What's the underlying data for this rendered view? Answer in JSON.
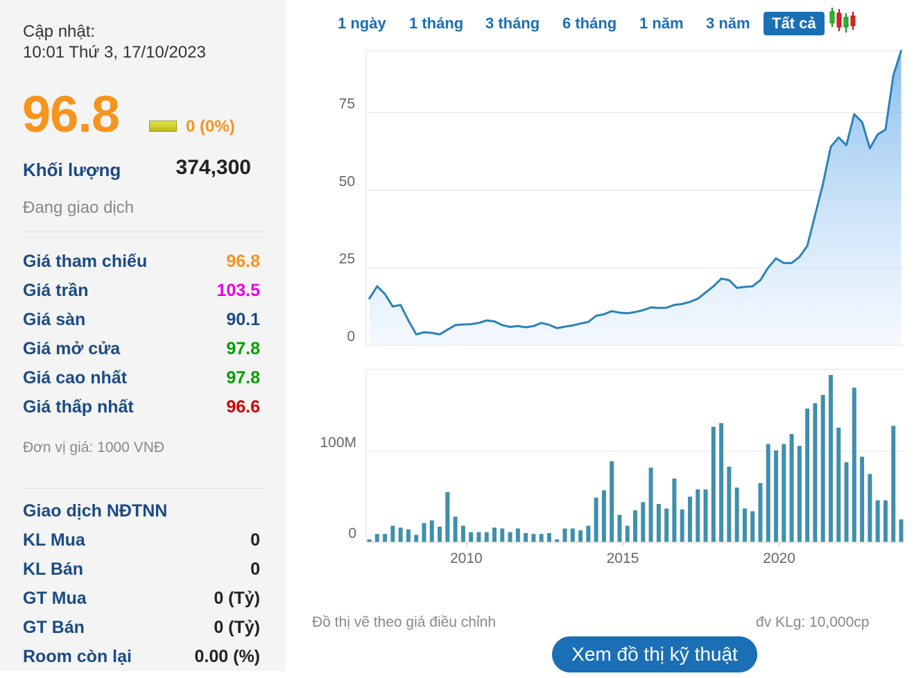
{
  "info": {
    "update_label": "Cập nhật:",
    "update_time": "10:01 Thứ 3, 17/10/2023",
    "price": "96.8",
    "change": "0 (0%)",
    "volume_label": "Khối lượng",
    "volume_value": "374,300",
    "status": "Đang giao dịch",
    "unit_note": "Đơn vị giá: 1000 VNĐ"
  },
  "colors": {
    "ref": "#f7941d",
    "ceiling": "#e600e6",
    "floor": "#1b4b84",
    "up": "#00a000",
    "down": "#d00000",
    "line": "#2b82b6",
    "bar": "#3f8fad"
  },
  "price_rows": [
    {
      "label": "Giá tham chiếu",
      "value": "96.8",
      "color": "#f7941d"
    },
    {
      "label": "Giá trần",
      "value": "103.5",
      "color": "#e600e6"
    },
    {
      "label": "Giá sàn",
      "value": "90.1",
      "color": "#1b4b84"
    },
    {
      "label": "Giá mở cửa",
      "value": "97.8",
      "color": "#00a000"
    },
    {
      "label": "Giá cao nhất",
      "value": "97.8",
      "color": "#00a000"
    },
    {
      "label": "Giá thấp nhất",
      "value": "96.6",
      "color": "#d00000"
    }
  ],
  "foreign": {
    "title": "Giao dịch NĐTNN",
    "rows": [
      {
        "label": "KL Mua",
        "value": "0"
      },
      {
        "label": "KL Bán",
        "value": "0"
      },
      {
        "label": "GT Mua",
        "value": "0 (Tỷ)"
      },
      {
        "label": "GT Bán",
        "value": "0 (Tỷ)"
      },
      {
        "label": "Room còn lại",
        "value": "0.00 (%)"
      }
    ]
  },
  "tabs": [
    {
      "label": "1 ngày",
      "active": false
    },
    {
      "label": "1 tháng",
      "active": false
    },
    {
      "label": "3 tháng",
      "active": false
    },
    {
      "label": "6 tháng",
      "active": false
    },
    {
      "label": "1 năm",
      "active": false
    },
    {
      "label": "3 năm",
      "active": false
    },
    {
      "label": "Tất cả",
      "active": true
    }
  ],
  "candle_icon": "candlestick-chart-icon",
  "footer": {
    "note_left": "Đồ thị vẽ theo giá điều chỉnh",
    "note_right": "đv KLg: 10,000cp",
    "button_label": "Xem đồ thị kỹ thuật"
  },
  "chart_data": [
    {
      "type": "area",
      "title": "",
      "xlabel": "",
      "ylabel": "",
      "x_ticks": [],
      "y_ticks": [
        "0",
        "25",
        "50",
        "75"
      ],
      "ylim": [
        0,
        95
      ],
      "xlim": [
        2006.8,
        2024.0
      ],
      "grid": true,
      "series": [
        {
          "x": [
            2006.9,
            2007.15,
            2007.4,
            2007.65,
            2007.9,
            2008.15,
            2008.4,
            2008.65,
            2008.9,
            2009.15,
            2009.4,
            2009.65,
            2009.9,
            2010.15,
            2010.4,
            2010.65,
            2010.9,
            2011.15,
            2011.4,
            2011.65,
            2011.9,
            2012.15,
            2012.4,
            2012.65,
            2012.9,
            2013.15,
            2013.4,
            2013.65,
            2013.9,
            2014.15,
            2014.4,
            2014.65,
            2014.9,
            2015.15,
            2015.4,
            2015.65,
            2015.9,
            2016.15,
            2016.4,
            2016.65,
            2016.9,
            2017.15,
            2017.4,
            2017.65,
            2017.9,
            2018.15,
            2018.4,
            2018.65,
            2018.9,
            2019.15,
            2019.4,
            2019.65,
            2019.9,
            2020.15,
            2020.4,
            2020.65,
            2020.9,
            2021.15,
            2021.4,
            2021.65,
            2021.9,
            2022.15,
            2022.4,
            2022.65,
            2022.9,
            2023.15,
            2023.4,
            2023.65,
            2023.9
          ],
          "values": [
            15,
            19,
            16.5,
            12.5,
            13,
            8,
            3.5,
            4.2,
            4,
            3.5,
            5,
            6.5,
            6.7,
            6.8,
            7.2,
            8,
            7.7,
            6.5,
            5.9,
            6.2,
            5.8,
            6.2,
            7.2,
            6.6,
            5.5,
            6,
            6.4,
            7,
            7.5,
            9.5,
            10,
            11,
            10.5,
            10.3,
            10.7,
            11.3,
            12.2,
            12,
            12.1,
            13,
            13.3,
            14,
            15,
            17,
            19,
            21.5,
            21,
            18.5,
            18.8,
            19,
            21,
            25,
            28,
            26.5,
            26.5,
            28.5,
            32,
            42,
            52,
            64,
            67,
            64.5,
            74.5,
            72,
            63.5,
            68,
            69.5,
            87,
            95
          ]
        }
      ]
    },
    {
      "type": "bar",
      "title": "",
      "xlabel": "",
      "ylabel": "",
      "x_ticks": [
        "2010",
        "2015",
        "2020"
      ],
      "y_ticks": [
        "0",
        "100M"
      ],
      "ylim": [
        0,
        190
      ],
      "grid": true,
      "series": [
        {
          "x": [
            2006.9,
            2007.15,
            2007.4,
            2007.65,
            2007.9,
            2008.15,
            2008.4,
            2008.65,
            2008.9,
            2009.15,
            2009.4,
            2009.65,
            2009.9,
            2010.15,
            2010.4,
            2010.65,
            2010.9,
            2011.15,
            2011.4,
            2011.65,
            2011.9,
            2012.15,
            2012.4,
            2012.65,
            2012.9,
            2013.15,
            2013.4,
            2013.65,
            2013.9,
            2014.15,
            2014.4,
            2014.65,
            2014.9,
            2015.15,
            2015.4,
            2015.65,
            2015.9,
            2016.15,
            2016.4,
            2016.65,
            2016.9,
            2017.15,
            2017.4,
            2017.65,
            2017.9,
            2018.15,
            2018.4,
            2018.65,
            2018.9,
            2019.15,
            2019.4,
            2019.65,
            2019.9,
            2020.15,
            2020.4,
            2020.65,
            2020.9,
            2021.15,
            2021.4,
            2021.65,
            2021.9,
            2022.15,
            2022.4,
            2022.65,
            2022.9,
            2023.15,
            2023.4,
            2023.65,
            2023.9
          ],
          "values": [
            3,
            9,
            9,
            18,
            16,
            14,
            8,
            21,
            24,
            17,
            55,
            28,
            18,
            11,
            11,
            11,
            16,
            15,
            11,
            15,
            10,
            9,
            9,
            10,
            3,
            15,
            15,
            13,
            18,
            49,
            57,
            89,
            30,
            18,
            35,
            44,
            82,
            42,
            37,
            70,
            36,
            50,
            58,
            58,
            127,
            131,
            83,
            60,
            37,
            34,
            65,
            108,
            101,
            108,
            119,
            106,
            147,
            153,
            162,
            184,
            126,
            88,
            170,
            94,
            75,
            46,
            46,
            128,
            25
          ]
        }
      ]
    }
  ]
}
